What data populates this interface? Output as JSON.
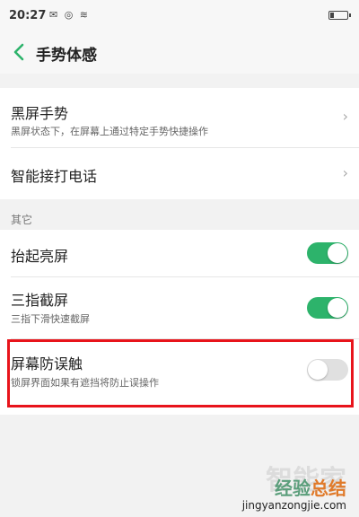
{
  "status_bar": {
    "time": "20:27",
    "icons_text": "✉ ◎ ≋"
  },
  "header": {
    "title": "手势体感"
  },
  "settings": {
    "black_screen_gesture": {
      "label": "黑屏手势",
      "sub": "黑屏状态下，在屏幕上通过特定手势快捷操作",
      "chevron": "›"
    },
    "smart_call": {
      "label": "智能接打电话",
      "chevron": "›"
    }
  },
  "other": {
    "section_title": "其它",
    "raise_to_wake": {
      "label": "抬起亮屏",
      "enabled": true
    },
    "three_finger_screenshot": {
      "label": "三指截屏",
      "sub": "三指下滑快速截屏",
      "enabled": true
    },
    "accidental_touch": {
      "label": "屏幕防误触",
      "sub": "锁屏界面如果有遮挡将防止误操作",
      "enabled": false
    }
  },
  "colors": {
    "accent": "#2db36b",
    "highlight": "#e8141b"
  },
  "watermark": {
    "ghost": "智能家",
    "main_left": "经验",
    "main_right": "总结",
    "url": "jingyanzongjie.com"
  }
}
